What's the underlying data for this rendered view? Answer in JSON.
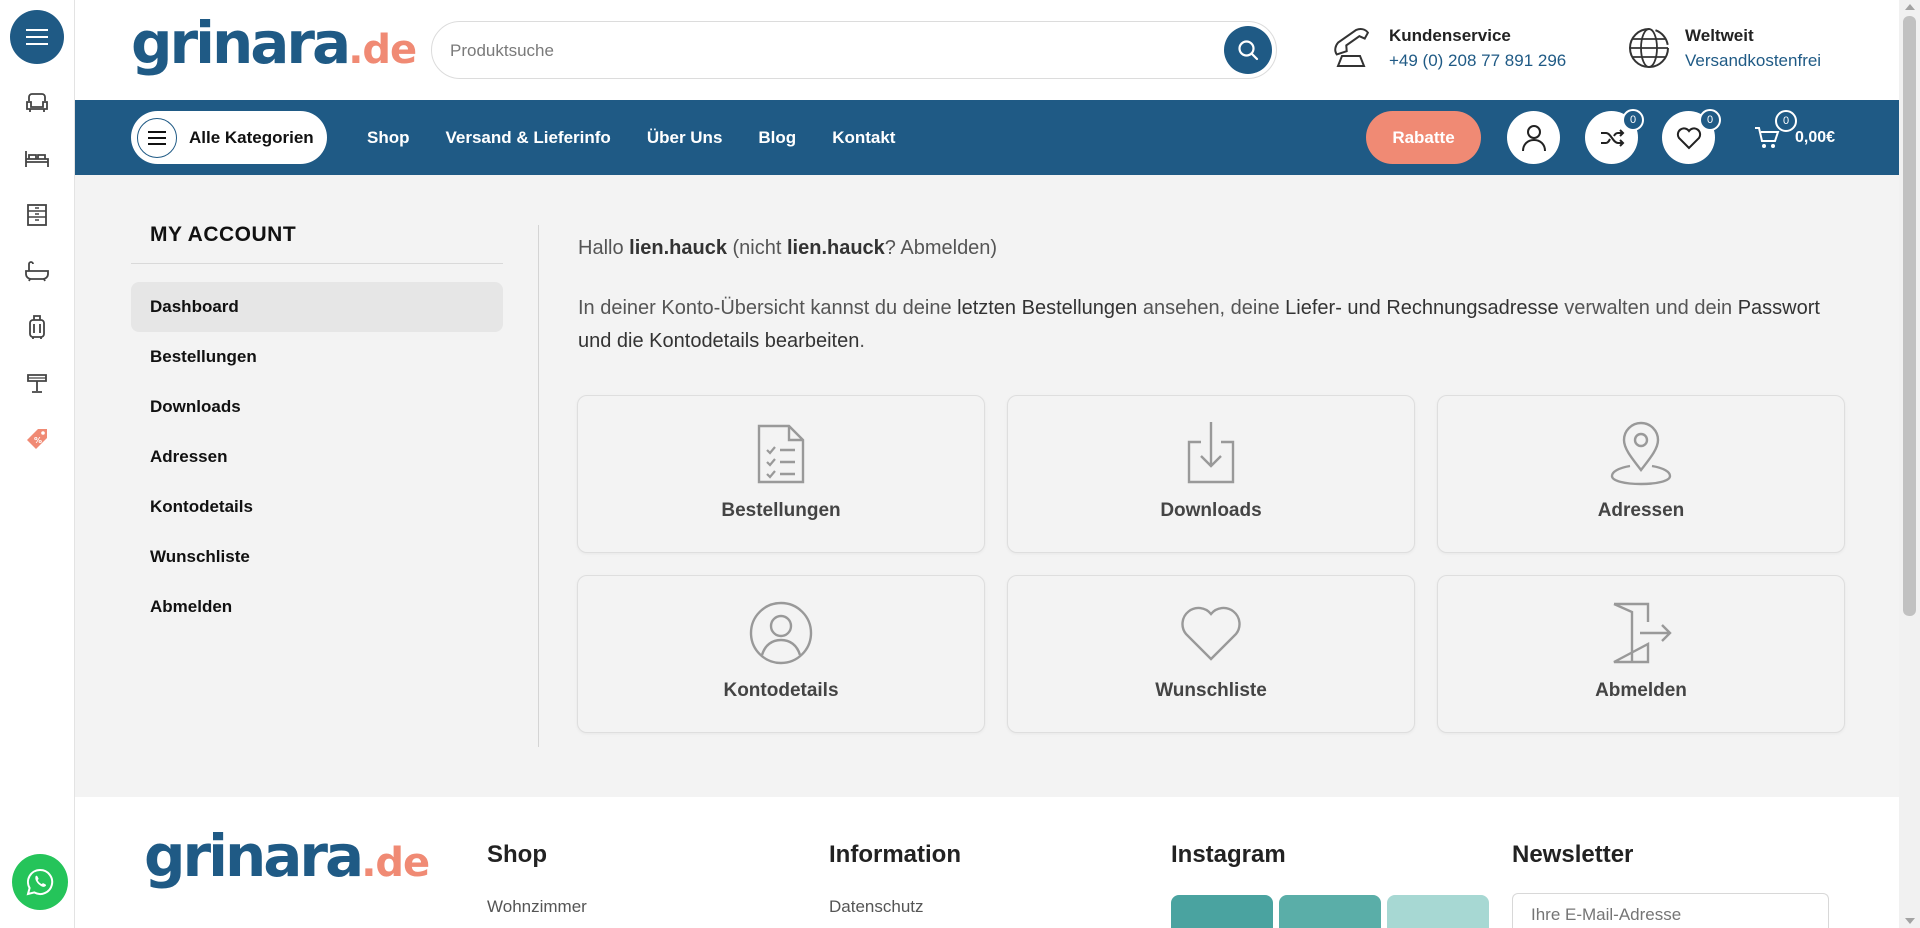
{
  "brand": {
    "name": "grinara",
    "tld": ".de",
    "primary_color": "#1f5a85",
    "accent_color": "#f08a74"
  },
  "rail": {
    "categories": [
      "armchair-icon",
      "bed-icon",
      "wardrobe-icon",
      "bathtub-icon",
      "luggage-icon",
      "lamp-icon",
      "sale-tag-icon"
    ],
    "whatsapp": "whatsapp-icon"
  },
  "header": {
    "search": {
      "placeholder": "Produktsuche"
    },
    "service": {
      "title": "Kundenservice",
      "phone": "+49 (0) 208 77 891 296"
    },
    "shipping": {
      "title": "Weltweit",
      "subtitle": "Versandkostenfrei"
    }
  },
  "nav": {
    "all_categories": "Alle Kategorien",
    "links": [
      "Shop",
      "Versand & Lieferinfo",
      "Über Uns",
      "Blog",
      "Kontakt"
    ],
    "rabatt": "Rabatte",
    "compare_count": "0",
    "wishlist_count": "0",
    "cart_count": "0",
    "cart_total": "0,00€"
  },
  "account": {
    "title": "MY ACCOUNT",
    "menu": [
      "Dashboard",
      "Bestellungen",
      "Downloads",
      "Adressen",
      "Kontodetails",
      "Wunschliste",
      "Abmelden"
    ],
    "active_index": 0,
    "greeting": {
      "prefix": "Hallo ",
      "user": "lien.hauck",
      "mid": " (nicht ",
      "user2": "lien.hauck",
      "suffix": "? Abmelden)"
    },
    "description": {
      "p1": "In deiner Konto-Übersicht kannst du deine ",
      "l1": "letzten Bestellungen",
      "p2": " ansehen, deine ",
      "l2": "Liefer- und Rechnungsadresse",
      "p3": " verwalten und dein ",
      "l3": "Passwort und die Kontodetails bearbeiten",
      "p4": "."
    },
    "cards": [
      {
        "label": "Bestellungen",
        "icon": "orders-clipboard-icon"
      },
      {
        "label": "Downloads",
        "icon": "download-icon"
      },
      {
        "label": "Adressen",
        "icon": "location-pin-icon"
      },
      {
        "label": "Kontodetails",
        "icon": "user-circle-icon"
      },
      {
        "label": "Wunschliste",
        "icon": "heart-icon"
      },
      {
        "label": "Abmelden",
        "icon": "logout-door-icon"
      }
    ]
  },
  "footer": {
    "shop": {
      "title": "Shop",
      "first_link": "Wohnzimmer"
    },
    "information": {
      "title": "Information",
      "first_link": "Datenschutz"
    },
    "instagram": {
      "title": "Instagram"
    },
    "newsletter": {
      "title": "Newsletter",
      "placeholder": "Ihre E-Mail-Adresse"
    }
  }
}
